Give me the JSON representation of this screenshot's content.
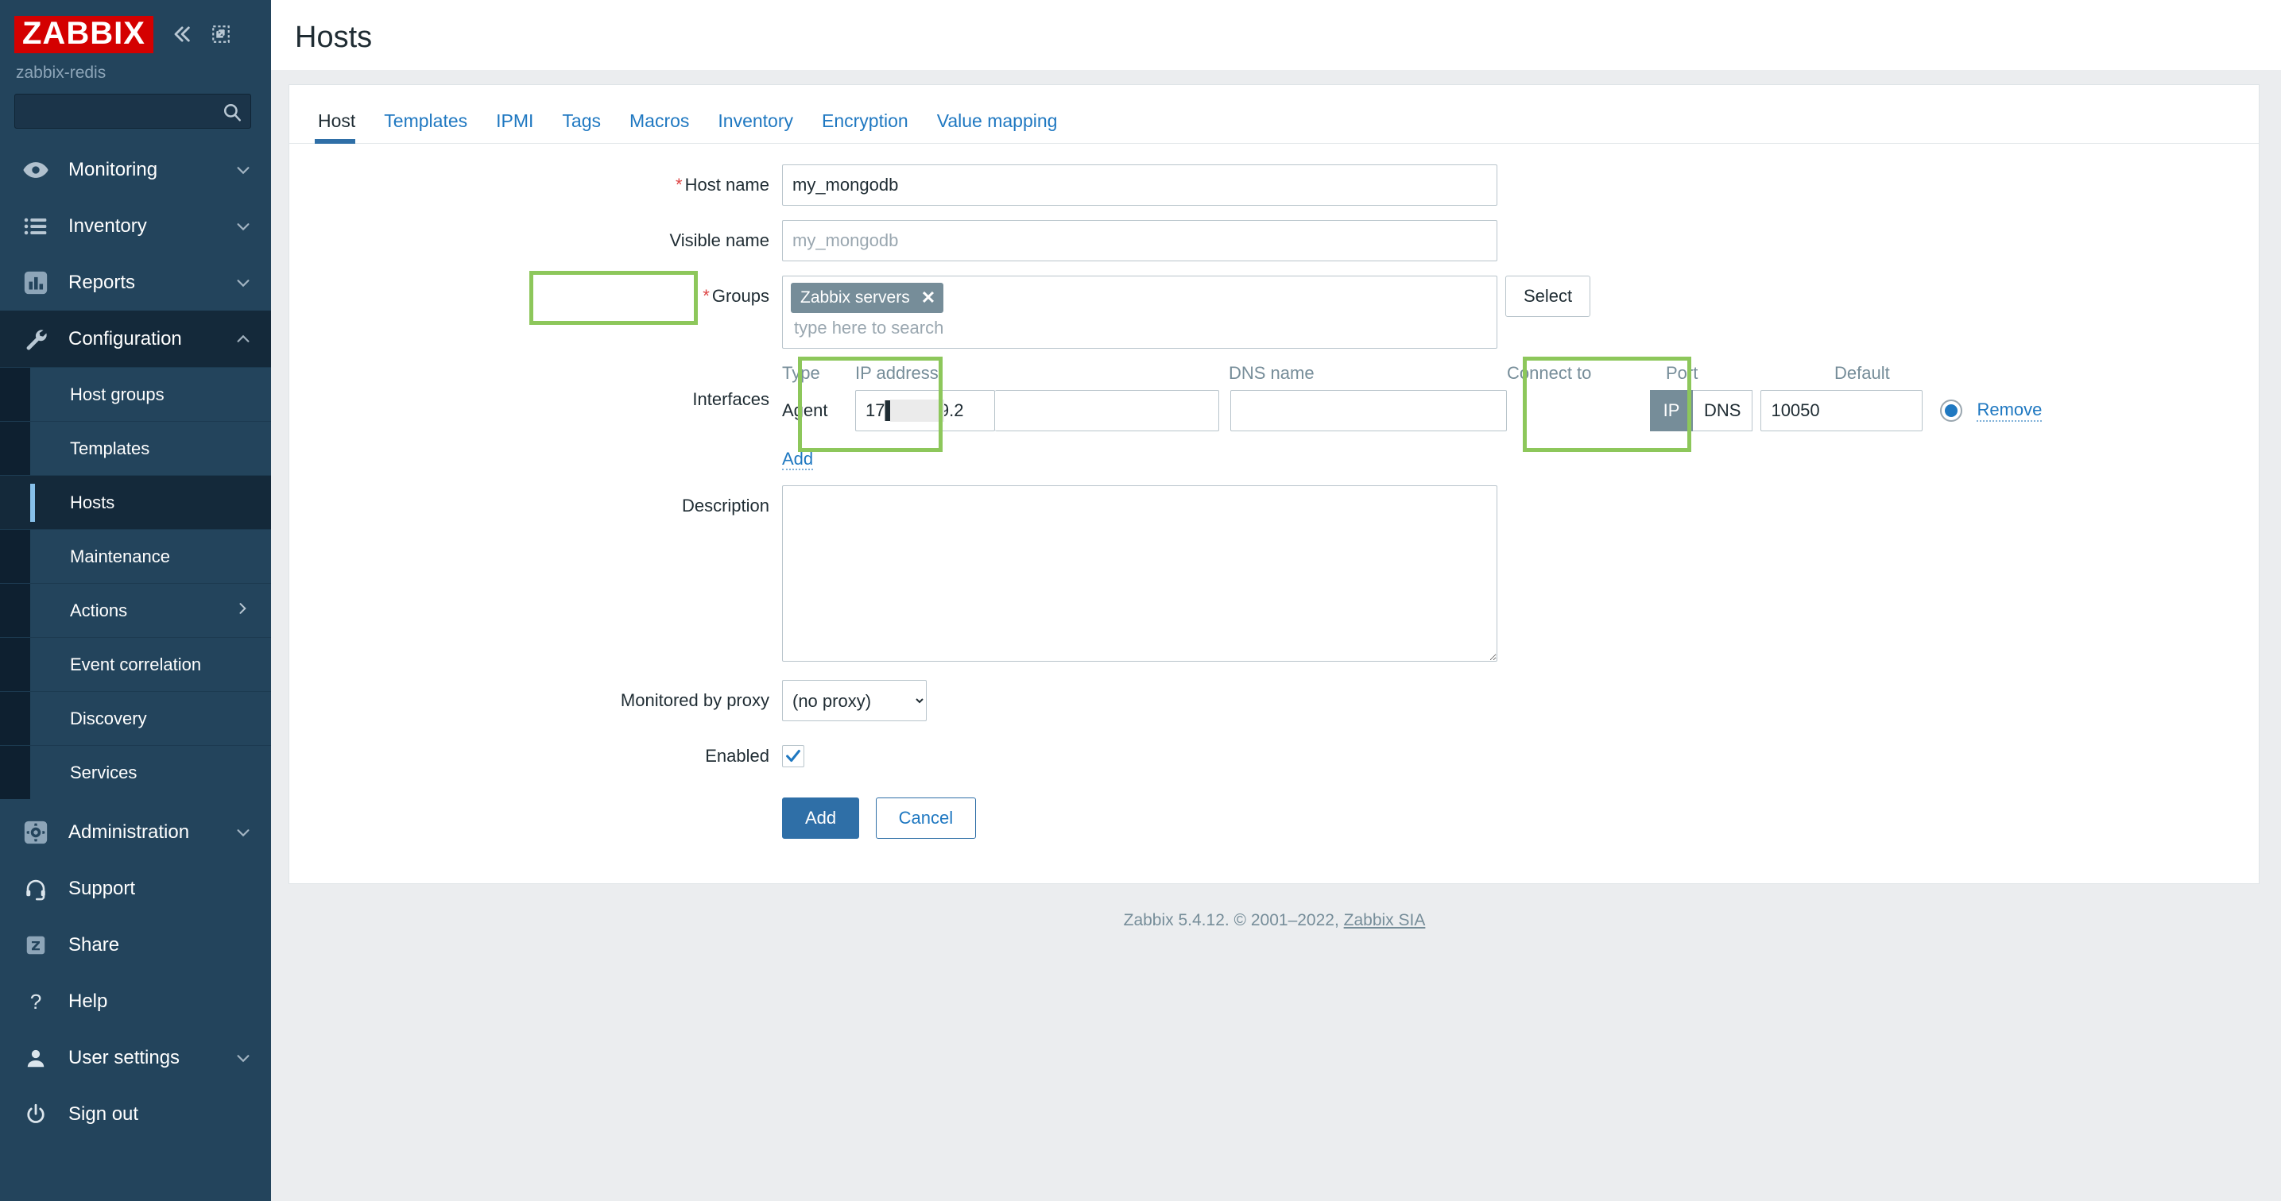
{
  "sidebar": {
    "logo_text": "ZABBIX",
    "server_name": "zabbix-redis",
    "collapse_icon": "double-chevron-left-icon",
    "compact_icon": "collapse-arrow-icon",
    "search": {
      "value": "",
      "placeholder": ""
    },
    "nav": [
      {
        "label": "Monitoring",
        "icon": "eye-icon",
        "chevron": "chevron-down",
        "active": false
      },
      {
        "label": "Inventory",
        "icon": "list-icon",
        "chevron": "chevron-down",
        "active": false
      },
      {
        "label": "Reports",
        "icon": "bar-chart-icon",
        "chevron": "chevron-down",
        "active": false
      },
      {
        "label": "Configuration",
        "icon": "wrench-icon",
        "chevron": "chevron-up",
        "active": true
      }
    ],
    "submenu": [
      {
        "label": "Host groups",
        "active": false,
        "chevron": ""
      },
      {
        "label": "Templates",
        "active": false,
        "chevron": ""
      },
      {
        "label": "Hosts",
        "active": true,
        "chevron": ""
      },
      {
        "label": "Maintenance",
        "active": false,
        "chevron": ""
      },
      {
        "label": "Actions",
        "active": false,
        "chevron": "chevron-right"
      },
      {
        "label": "Event correlation",
        "active": false,
        "chevron": ""
      },
      {
        "label": "Discovery",
        "active": false,
        "chevron": ""
      },
      {
        "label": "Services",
        "active": false,
        "chevron": ""
      }
    ],
    "bottom_nav": [
      {
        "label": "Administration",
        "icon": "gear-icon",
        "chevron": "chevron-down"
      },
      {
        "label": "Support",
        "icon": "headset-icon",
        "chevron": ""
      },
      {
        "label": "Share",
        "icon": "zabbix-z-icon",
        "chevron": ""
      },
      {
        "label": "Help",
        "icon": "question-icon",
        "chevron": ""
      },
      {
        "label": "User settings",
        "icon": "person-icon",
        "chevron": "chevron-down"
      },
      {
        "label": "Sign out",
        "icon": "power-icon",
        "chevron": ""
      }
    ]
  },
  "header": {
    "title": "Hosts"
  },
  "tabs": [
    {
      "label": "Host",
      "active": true
    },
    {
      "label": "Templates",
      "active": false
    },
    {
      "label": "IPMI",
      "active": false
    },
    {
      "label": "Tags",
      "active": false
    },
    {
      "label": "Macros",
      "active": false
    },
    {
      "label": "Inventory",
      "active": false
    },
    {
      "label": "Encryption",
      "active": false
    },
    {
      "label": "Value mapping",
      "active": false
    }
  ],
  "form": {
    "host_name": {
      "label": "Host name",
      "required": true,
      "value": "my_mongodb",
      "placeholder": ""
    },
    "visible_name": {
      "label": "Visible name",
      "required": false,
      "value": "",
      "placeholder": "my_mongodb"
    },
    "groups": {
      "label": "Groups",
      "required": true,
      "chips": [
        {
          "label": "Zabbix servers",
          "remove_icon": "close-icon"
        }
      ],
      "placeholder": "type here to search",
      "select_button": "Select"
    },
    "interfaces": {
      "label": "Interfaces",
      "columns": [
        "Type",
        "IP address",
        "DNS name",
        "Connect to",
        "Port",
        "Default"
      ],
      "rows": [
        {
          "type": "Agent",
          "ip": "17████ 9.2",
          "dns": "",
          "connect_to": {
            "options": [
              "IP",
              "DNS"
            ],
            "selected": "IP"
          },
          "port": "10050",
          "default_selected": true,
          "remove_label": "Remove"
        }
      ],
      "add_label": "Add"
    },
    "description": {
      "label": "Description",
      "value": "",
      "placeholder": ""
    },
    "proxy": {
      "label": "Monitored by proxy",
      "selected": "(no proxy)",
      "options": [
        "(no proxy)"
      ]
    },
    "enabled": {
      "label": "Enabled",
      "checked": true
    },
    "submit_label": "Add",
    "cancel_label": "Cancel"
  },
  "footer": {
    "text": "Zabbix 5.4.12. © 2001–2022, ",
    "link": "Zabbix SIA"
  },
  "colors": {
    "sidebar_bg": "#23445c",
    "sidebar_active": "#14293a",
    "brand_red": "#d40000",
    "link_blue": "#1f78c1",
    "primary_blue": "#2f6fa7",
    "chip_gray": "#768d99",
    "highlight_green": "#8dc75b"
  }
}
